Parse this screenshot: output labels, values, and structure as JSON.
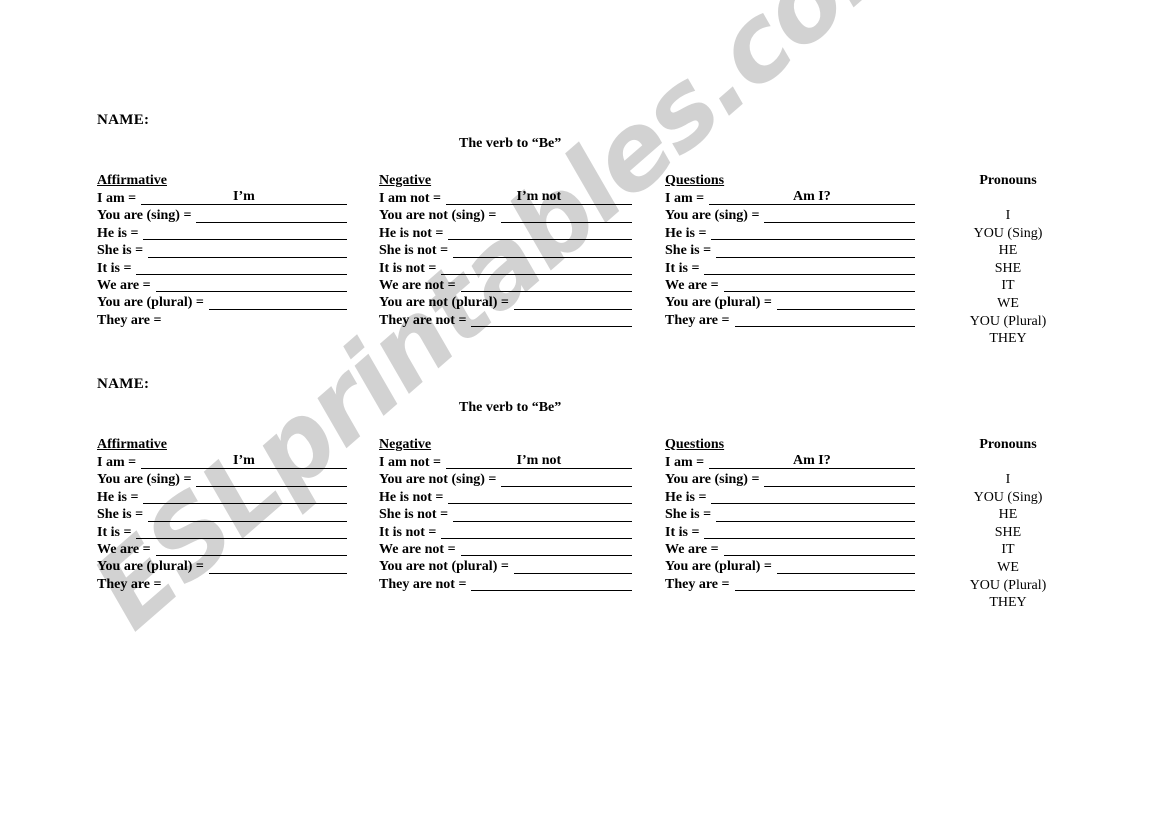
{
  "watermark": {
    "text": "ESLprintables.com",
    "color": "#d2d2d2"
  },
  "worksheet": {
    "name_label": "NAME:",
    "title": "The verb to “Be”",
    "columns": [
      {
        "header": "Affirmative",
        "rows": [
          {
            "prompt": "I am =",
            "answer": "I’m",
            "line": true
          },
          {
            "prompt": "You are (sing) =",
            "answer": "",
            "line": true
          },
          {
            "prompt": "He is =",
            "answer": "",
            "line": true
          },
          {
            "prompt": "She is =",
            "answer": "",
            "line": true
          },
          {
            "prompt": "It is =",
            "answer": "",
            "line": true
          },
          {
            "prompt": "We are =",
            "answer": "",
            "line": true
          },
          {
            "prompt": "You are (plural) =",
            "answer": "",
            "line": true
          },
          {
            "prompt": "They are =",
            "answer": "",
            "line": false
          }
        ]
      },
      {
        "header": "Negative",
        "rows": [
          {
            "prompt": "I am not =",
            "answer": "I’m not",
            "line": true
          },
          {
            "prompt": "You are not (sing) =",
            "answer": "",
            "line": true
          },
          {
            "prompt": "He is not =",
            "answer": "",
            "line": true
          },
          {
            "prompt": "She is not =",
            "answer": "",
            "line": true
          },
          {
            "prompt": "It is not =",
            "answer": "",
            "line": true
          },
          {
            "prompt": "We are not =",
            "answer": "",
            "line": true
          },
          {
            "prompt": "You are not (plural) =",
            "answer": "",
            "line": true
          },
          {
            "prompt": "They are not =",
            "answer": "",
            "line": true
          }
        ]
      },
      {
        "header": "Questions",
        "rows": [
          {
            "prompt": "I am =",
            "answer": "Am I?",
            "line": true
          },
          {
            "prompt": "You are (sing) =",
            "answer": "",
            "line": true
          },
          {
            "prompt": "He is =",
            "answer": "",
            "line": true
          },
          {
            "prompt": "She is =",
            "answer": "",
            "line": true
          },
          {
            "prompt": "It is =",
            "answer": "",
            "line": true
          },
          {
            "prompt": "We are =",
            "answer": "",
            "line": true
          },
          {
            "prompt": "You are (plural) =",
            "answer": "",
            "line": true
          },
          {
            "prompt": "They are =",
            "answer": "",
            "line": true
          }
        ]
      }
    ],
    "pronouns": {
      "header": "Pronouns",
      "items": [
        "I",
        "YOU (Sing)",
        "HE",
        "SHE",
        "IT",
        "WE",
        "YOU (Plural)",
        "THEY"
      ]
    }
  },
  "copies": 2
}
